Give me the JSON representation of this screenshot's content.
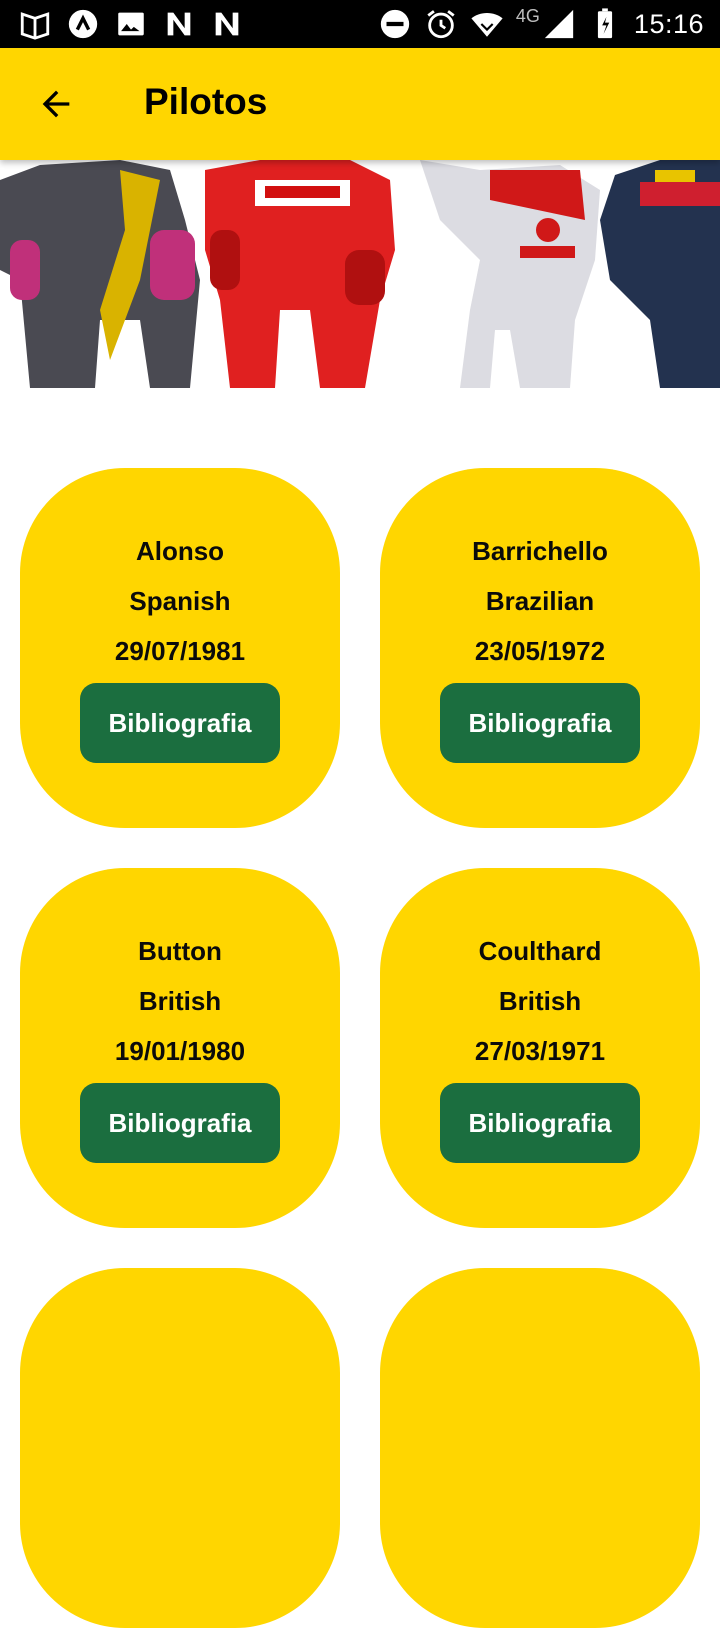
{
  "status_bar": {
    "time": "15:16",
    "network": "4G",
    "left_icons": [
      "reading-mode-icon",
      "app-icon",
      "gallery-icon",
      "n-icon",
      "n-icon"
    ],
    "right_icons": [
      "do-not-disturb-icon",
      "alarm-icon",
      "wifi-icon",
      "signal-icon",
      "battery-icon"
    ]
  },
  "app_bar": {
    "title": "Pilotos",
    "back_icon": "arrow-left-icon"
  },
  "pilots": [
    {
      "name": "Alonso",
      "nationality": "Spanish",
      "dob": "29/07/1981",
      "button": "Bibliografia"
    },
    {
      "name": "Barrichello",
      "nationality": "Brazilian",
      "dob": "23/05/1972",
      "button": "Bibliografia"
    },
    {
      "name": "Button",
      "nationality": "British",
      "dob": "19/01/1980",
      "button": "Bibliografia"
    },
    {
      "name": "Coulthard",
      "nationality": "British",
      "dob": "27/03/1971",
      "button": "Bibliografia"
    }
  ],
  "colors": {
    "app_bar": "#ffd600",
    "card": "#ffd600",
    "button": "#1b6e3f"
  }
}
